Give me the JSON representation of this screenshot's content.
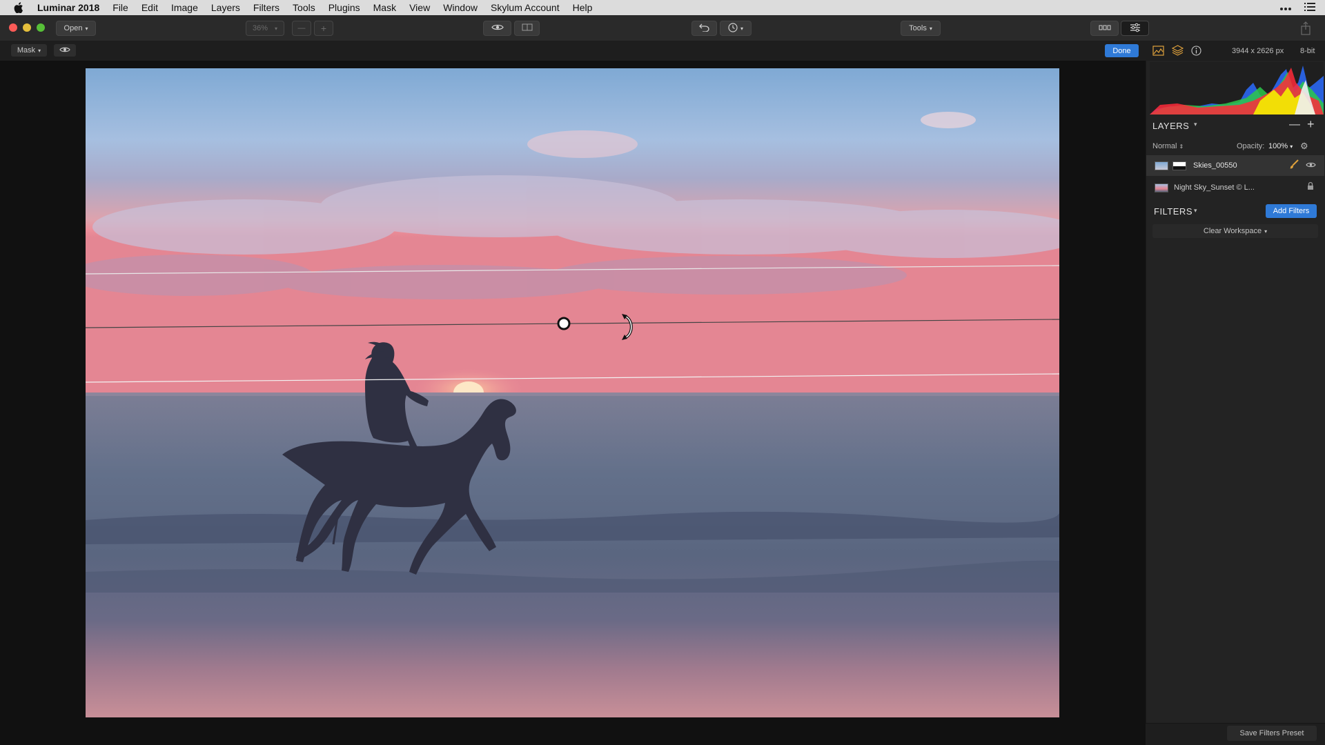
{
  "menubar": {
    "app_name": "Luminar 2018",
    "items": [
      "File",
      "Edit",
      "Image",
      "Layers",
      "Filters",
      "Tools",
      "Plugins",
      "Mask",
      "View",
      "Window",
      "Skylum Account",
      "Help"
    ]
  },
  "toolbar": {
    "open_label": "Open",
    "zoom_value": "36%",
    "zoom_out": "—",
    "zoom_in": "+",
    "tools_label": "Tools"
  },
  "subbar": {
    "mask_label": "Mask",
    "done_label": "Done",
    "dimensions": "3944 x 2626 px",
    "bit_depth": "8-bit"
  },
  "layers": {
    "title": "LAYERS",
    "blend_mode": "Normal",
    "opacity_label": "Opacity:",
    "opacity_value": "100%",
    "items": [
      {
        "name": "Skies_00550"
      },
      {
        "name": "Night Sky_Sunset © L..."
      }
    ]
  },
  "filters": {
    "title": "FILTERS",
    "add_label": "Add Filters",
    "clear_label": "Clear Workspace"
  },
  "footer": {
    "save_preset_label": "Save Filters Preset"
  },
  "colors": {
    "accent": "#2f7ad7",
    "panel_bg": "#232323",
    "toolbar_bg": "#2a2a2a",
    "canvas_bg": "#111111"
  }
}
